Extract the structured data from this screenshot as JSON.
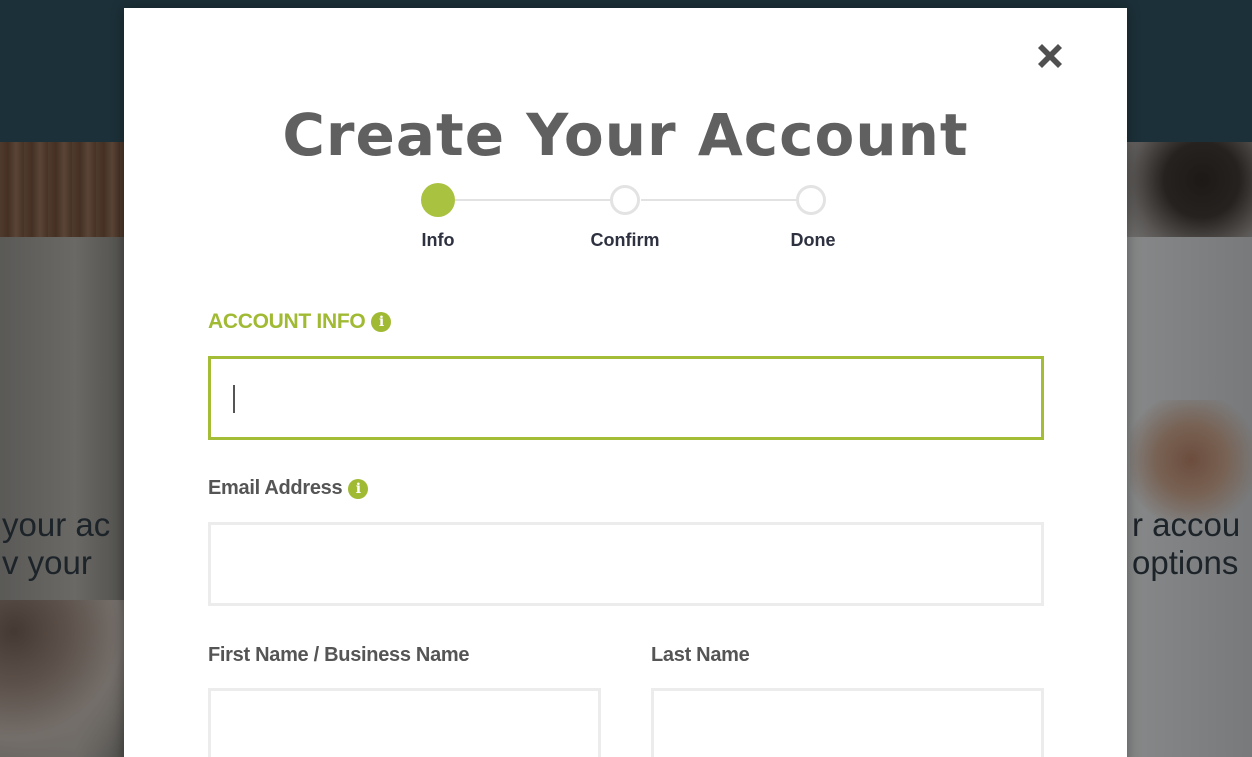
{
  "background": {
    "left_text_line1": "your ac",
    "left_text_line2": "v your",
    "right_text_line1": "r accou",
    "right_text_line2": "options"
  },
  "modal": {
    "title": "Create Your Account",
    "close_icon": "close-x-icon",
    "steps": [
      {
        "label": "Info",
        "state": "active"
      },
      {
        "label": "Confirm",
        "state": "inactive"
      },
      {
        "label": "Done",
        "state": "inactive"
      }
    ],
    "section_title": "ACCOUNT INFO",
    "account_field": {
      "value": "",
      "placeholder": ""
    },
    "email": {
      "label": "Email Address",
      "value": "",
      "placeholder": ""
    },
    "first_name": {
      "label": "First Name / Business Name",
      "value": "",
      "placeholder": ""
    },
    "last_name": {
      "label": "Last Name",
      "value": "",
      "placeholder": ""
    },
    "info_glyph": "i"
  },
  "colors": {
    "accent_green": "#a9c23f",
    "header_teal": "#2b4a58",
    "title_gray": "#606060"
  }
}
